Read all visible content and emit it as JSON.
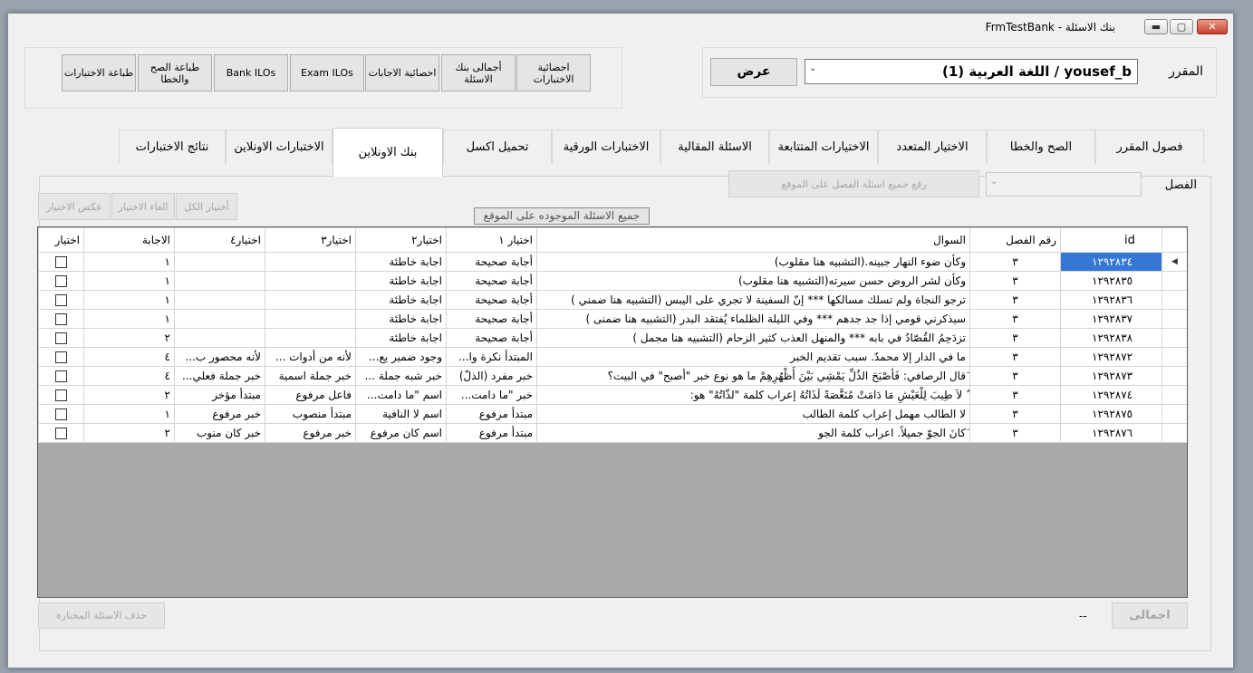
{
  "window": {
    "title": "FrmTestBank - بنك الاسئلة",
    "minimize": "▬",
    "maximize": "▢",
    "close": "✕"
  },
  "toolbar_buttons": [
    {
      "label": "احصائية الاختبارات"
    },
    {
      "label": "أجمالى بنك الاسئلة"
    },
    {
      "label": "احصائية الاجابات"
    },
    {
      "label": "Exam ILOs"
    },
    {
      "label": "Bank ILOs"
    },
    {
      "label": "طباعة الصح والخطا"
    },
    {
      "label": "طباعة الاختبارات"
    }
  ],
  "course": {
    "label": "المقرر",
    "value": "اللغة العربية (1) / yousef_b",
    "show_button": "عرض",
    "arrow": "⌄"
  },
  "tabs": [
    {
      "label": "فصول المقرر"
    },
    {
      "label": "الصح والخطا"
    },
    {
      "label": "الاختيار المتعدد"
    },
    {
      "label": "الاختيارات المتتابعة"
    },
    {
      "label": "الاسئلة المقالية"
    },
    {
      "label": "الاختبارات الورقية"
    },
    {
      "label": "تحميل اكسل"
    },
    {
      "label": "بنك الاونلاين"
    },
    {
      "label": "الاختبارات الاونلاين"
    },
    {
      "label": "نتائج الاختبارات"
    }
  ],
  "chapter": {
    "label": "الفصل",
    "arrow": "⌄",
    "upload_button": "رفع جميع اسئلة الفصل على الموقع"
  },
  "selection_buttons": {
    "select_all": "أختيار الكل",
    "cancel": "الغاء الاختيار",
    "invert": "عكس الاختيار"
  },
  "online_questions_button": "جميع الاسئلة الموجوده على الموقع",
  "grid": {
    "columns": [
      "id",
      "رقم الفصل",
      "السوال",
      "اختيار ١",
      "اختيار٢",
      "اختيار٣",
      "اختيار٤",
      "الاجابة",
      "اختيار"
    ],
    "row_indicator": "◀",
    "rows": [
      [
        "١٢٩٢٨٣٤",
        "٣",
        "وكأن ضوء النهار جبينه.(التشبيه هنا مقلوب)",
        "أجابة صحيحة",
        "اجابة خاطئة",
        "",
        "",
        "١"
      ],
      [
        "١٢٩٢٨٣٥",
        "٣",
        "وكأن لشر الروض حسن سيرته(التشبيه هنا مقلوب)",
        "أجابة صحيحة",
        "اجابة خاطئة",
        "",
        "",
        "١"
      ],
      [
        "١٢٩٢٨٣٦",
        "٣",
        "ترجو النجاة ولم تسلك مسالكها *** إنّ السفينة لا تجري على اليبس (التشبيه هنا ضمني )",
        "أجابة صحيحة",
        "اجابة خاطئة",
        "",
        "",
        "١"
      ],
      [
        "١٢٩٢٨٣٧",
        "٣",
        "سيذكرني قومي إذا جد جدهم *** وفي الليلة الظلماء يُفتقد البدر (التشبيه هنا ضمنى )",
        "أجابة صحيحة",
        "اجابة خاطئة",
        "",
        "",
        "١"
      ],
      [
        "١٢٩٢٨٣٨",
        "٣",
        "تزدَحِمُ القُصّادُ في بابه *** والمنهل العذب كثير الزحام (التشبيه هنا مجمل )",
        "أجابة صحيحة",
        "اجابة خاطئة",
        "",
        "",
        "٢"
      ],
      [
        "١٢٩٢٨٧٢",
        "٣",
        "ما في الدار إلا محمدٌ. سبب تقديم الخبر",
        "المبتدأ نكرة وا...",
        "وجود ضمير يع...",
        "لأنه من أدوات ...",
        "لأنه محصور ب...",
        "٤"
      ],
      [
        "١٢٩٢٨٧٣",
        "٣",
        "َقال الرصافي: فَأصْبَحَ الذُلِّ يَمْشِي بَيْنَ أَظْهُرِهِمْ ما هو نوع خبر \"أصبح\" في البيت؟",
        "خبر مفرد (الذلّ)",
        "خبر شبه جملة ...",
        "خبر جملة اسمية",
        "خبر جملة فعلي...",
        "٤"
      ],
      [
        "١٢٩٢٨٧٤",
        "٣",
        "ٌ لاَ طِيبَ لِلْعَيْشِ مَا دَامَتْ مُنَغَّصَةً لَذَاتُهُ إعراب كلمة \"لذّاتُهُ\" هو:",
        "خبر \"ما دامت...",
        "اسم \"ما دامت...",
        "فاعل مرفوع",
        "مبتدأ مؤخر",
        "٢"
      ],
      [
        "١٢٩٢٨٧٥",
        "٣",
        "لا الطالب مهمل إعراب كلمة الطالب",
        "مبتدأ مرفوع",
        "اسم لا النافية",
        "مبتدأ منصوب",
        "خبر مرفوع",
        "١"
      ],
      [
        "١٢٩٢٨٧٦",
        "٣",
        "َكانَ الجوّ جميلاً. اعراب كلمة الجو",
        "مبتدأ مرفوع",
        "اسم كان مرفوع",
        "خبر مرفوع",
        "خبر كان منوب",
        "٢"
      ]
    ]
  },
  "footer": {
    "delete_selected": "حذف الاسئلة المختارة",
    "total_button": "اجمالى",
    "total_value": "--"
  }
}
